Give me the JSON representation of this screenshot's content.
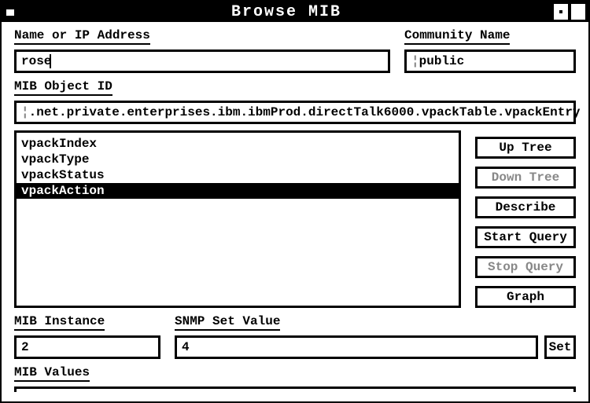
{
  "title": "Browse MIB",
  "labels": {
    "name_ip": "Name or IP Address",
    "community": "Community Name",
    "object_id": "MIB Object ID",
    "instance": "MIB Instance",
    "set_value": "SNMP Set Value",
    "mib_values": "MIB Values"
  },
  "inputs": {
    "name_ip": "rose",
    "community": "public",
    "object_id": ".net.private.enterprises.ibm.ibmProd.directTalk6000.vpackTable.vpackEntry",
    "instance": "2",
    "set_value": "4"
  },
  "list": {
    "items": [
      "vpackIndex",
      "vpackType",
      "vpackStatus",
      "vpackAction"
    ],
    "selected": "vpackAction"
  },
  "buttons": {
    "up_tree": "Up Tree",
    "down_tree": "Down Tree",
    "describe": "Describe",
    "start_query": "Start Query",
    "stop_query": "Stop Query",
    "graph": "Graph",
    "set": "Set"
  }
}
